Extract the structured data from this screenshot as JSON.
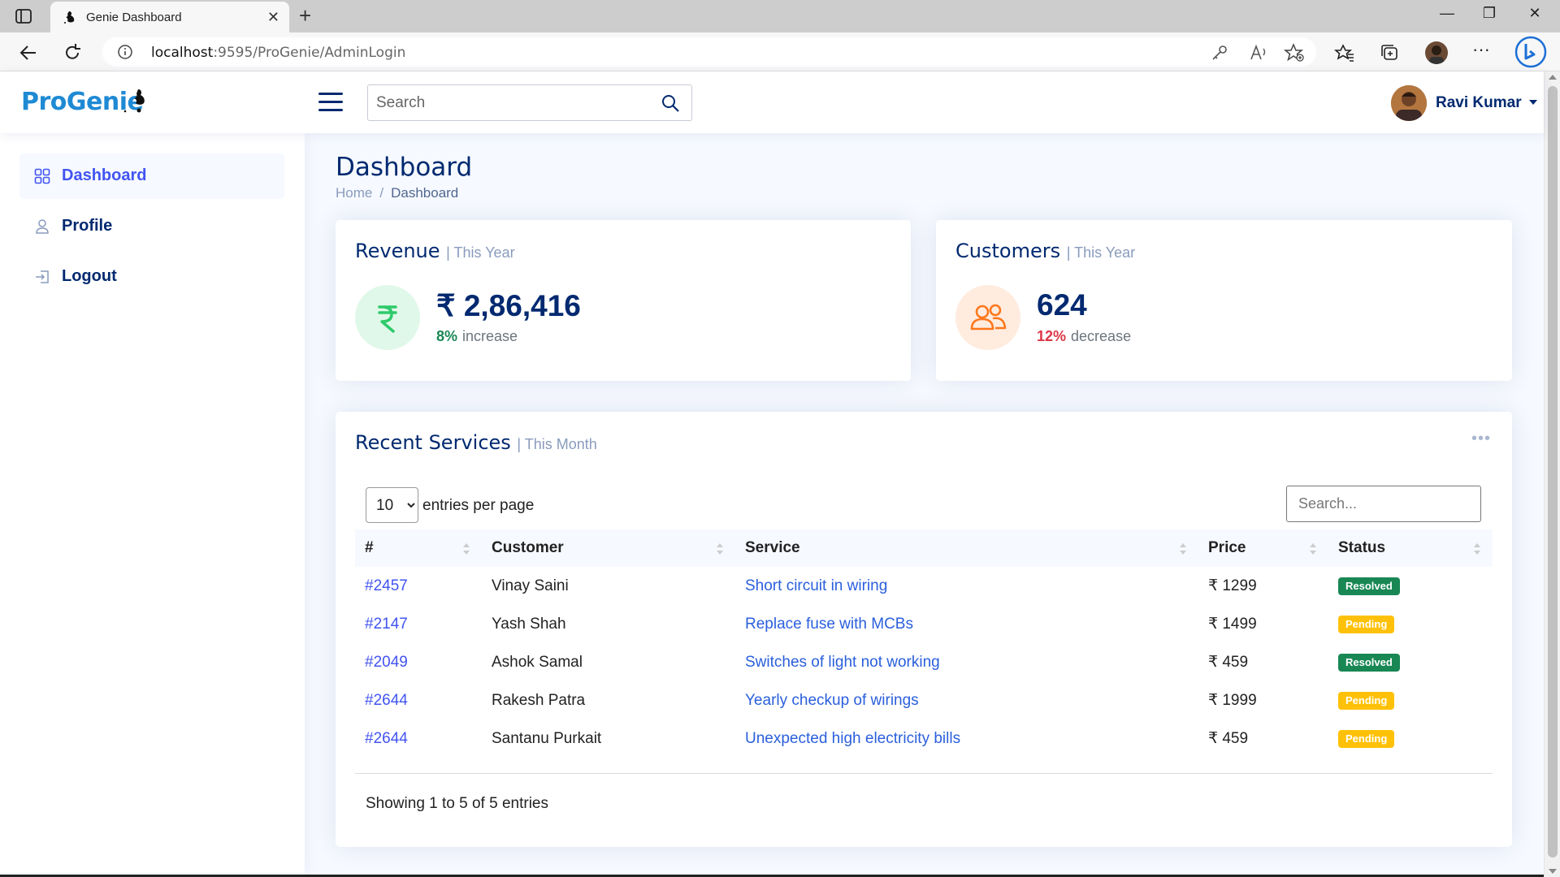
{
  "browser": {
    "tab_title": "Genie Dashboard",
    "url_host": "localhost",
    "url_path": ":9595/ProGenie/AdminLogin"
  },
  "header": {
    "logo_text": "ProGenie",
    "search_placeholder": "Search",
    "user_name": "Ravi Kumar"
  },
  "sidebar": {
    "items": [
      {
        "label": "Dashboard",
        "icon": "grid-icon",
        "active": true
      },
      {
        "label": "Profile",
        "icon": "person-icon",
        "active": false
      },
      {
        "label": "Logout",
        "icon": "box-arrow-in-right-icon",
        "active": false
      }
    ]
  },
  "page": {
    "title": "Dashboard",
    "breadcrumb": [
      "Home",
      "Dashboard"
    ]
  },
  "revenue": {
    "title": "Revenue",
    "period": "| This Year",
    "value": "₹ 2,86,416",
    "change_pct": "8%",
    "change_text": "increase",
    "icon": "rupee-icon",
    "color": "#2eca6a"
  },
  "customers": {
    "title": "Customers",
    "period": "| This Year",
    "value": "624",
    "change_pct": "12%",
    "change_text": "decrease",
    "icon": "people-icon",
    "color": "#ff771d"
  },
  "recent_services": {
    "title": "Recent Services",
    "period": "| This Month",
    "per_page_value": "10",
    "per_page_label": "entries per page",
    "search_placeholder": "Search...",
    "columns": [
      "#",
      "Customer",
      "Service",
      "Price",
      "Status"
    ],
    "rows": [
      {
        "id": "#2457",
        "customer": "Vinay Saini",
        "service": "Short circuit in wiring",
        "price": "₹ 1299",
        "status": "Resolved"
      },
      {
        "id": "#2147",
        "customer": "Yash Shah",
        "service": "Replace fuse with MCBs",
        "price": "₹ 1499",
        "status": "Pending"
      },
      {
        "id": "#2049",
        "customer": "Ashok Samal",
        "service": "Switches of light not working",
        "price": "₹ 459",
        "status": "Resolved"
      },
      {
        "id": "#2644",
        "customer": "Rakesh Patra",
        "service": "Yearly checkup of wirings",
        "price": "₹ 1999",
        "status": "Pending"
      },
      {
        "id": "#2644",
        "customer": "Santanu Purkait",
        "service": "Unexpected high electricity bills",
        "price": "₹ 459",
        "status": "Pending"
      }
    ],
    "info": "Showing 1 to 5 of 5 entries"
  },
  "colors": {
    "navy": "#012970",
    "accent": "#4154f1",
    "resolved": "#198754",
    "pending": "#ffc107"
  }
}
